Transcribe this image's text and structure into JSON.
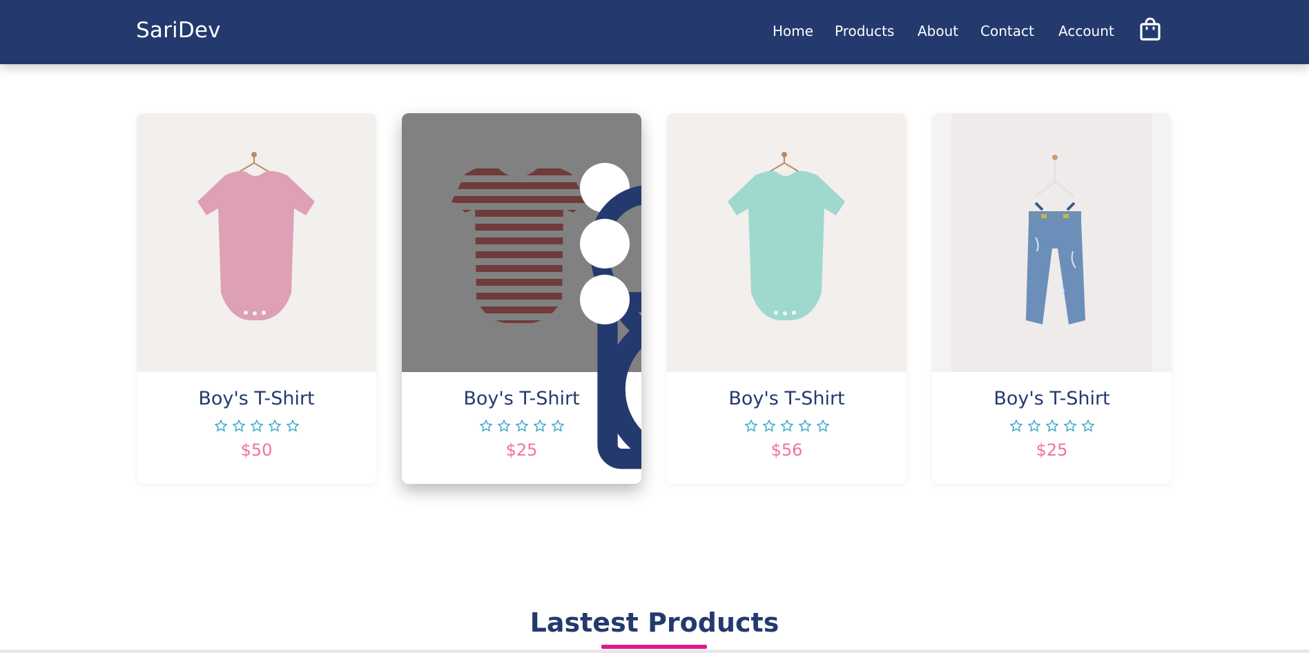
{
  "header": {
    "brand": "SariDev",
    "nav": [
      "Home",
      "Products",
      "About",
      "Contact",
      "Account"
    ],
    "cart_icon": "shopping-bag-icon"
  },
  "colors": {
    "header_bg": "#243a6e",
    "title": "#243a6e",
    "price": "#f0739a",
    "stars": "#3aa8c8",
    "accent_underline": "#e0188e"
  },
  "products": [
    {
      "title": "Boy's T-Shirt",
      "price": "$50",
      "rating": 0,
      "image": "pink-onesie"
    },
    {
      "title": "Boy's T-Shirt",
      "price": "$25",
      "rating": 0,
      "image": "striped-onesie"
    },
    {
      "title": "Boy's T-Shirt",
      "price": "$56",
      "rating": 0,
      "image": "mint-onesie"
    },
    {
      "title": "Boy's T-Shirt",
      "price": "$25",
      "rating": 0,
      "image": "denim-overalls"
    }
  ],
  "hover_actions": [
    "heart-icon",
    "shopping-bag-icon",
    "search-icon"
  ],
  "section": {
    "title": "Lastest Products"
  }
}
